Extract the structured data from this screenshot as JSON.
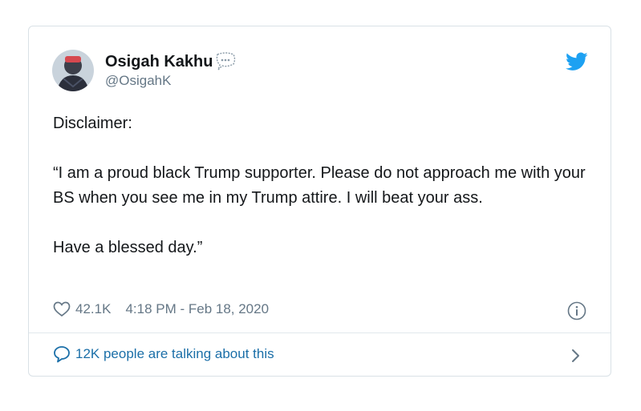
{
  "tweet": {
    "display_name": "Osigah Kakhu",
    "handle": "@OsigahK",
    "paragraphs": [
      "Disclaimer:",
      "“I am a proud black Trump supporter. Please do not approach me with your BS when you see me in my Trump attire. I will beat your ass.",
      "Have a blessed day.”"
    ],
    "likes": "42.1K",
    "timestamp": "4:18 PM - Feb 18, 2020",
    "talking": "12K people are talking about this"
  },
  "icons": {
    "badge": "speech-bubble-badge-icon",
    "brand": "twitter-bird-icon",
    "like": "heart-icon",
    "info": "info-icon",
    "conversation": "chat-bubble-icon",
    "next": "chevron-right-icon"
  },
  "colors": {
    "brand": "#1da1f2",
    "link": "#1b6fa8",
    "muted": "#657786",
    "text": "#14171a",
    "border": "#d9e1e6"
  }
}
